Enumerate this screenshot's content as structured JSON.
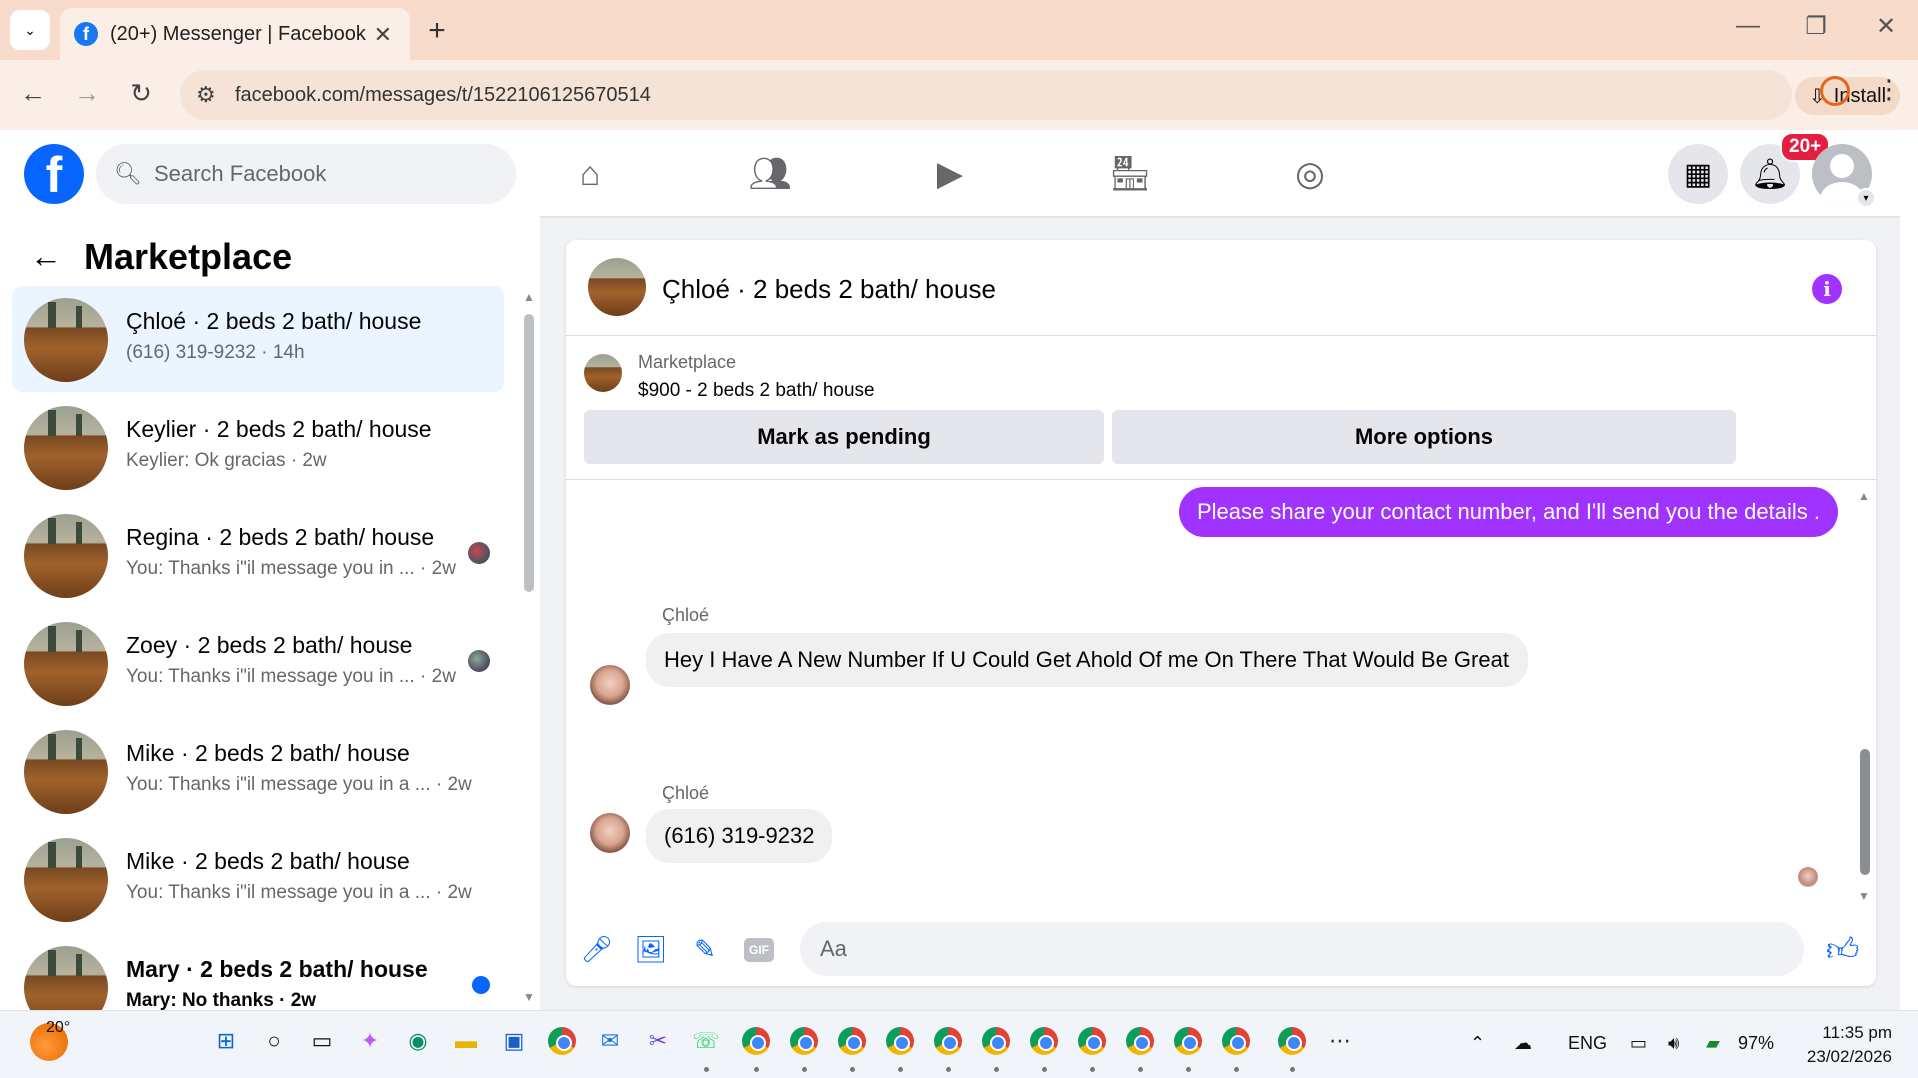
{
  "browser": {
    "tab_title": "(20+) Messenger | Facebook",
    "url": "facebook.com/messages/t/1522106125670514",
    "install_label": "Install"
  },
  "facebook": {
    "search_placeholder": "Search Facebook",
    "notifications_badge": "20+"
  },
  "sidebar": {
    "title": "Marketplace",
    "conversations": [
      {
        "name": "Çhloé · 2 beds 2 bath/ house",
        "snippet": "(616) 319-9232 · 14h",
        "active": true
      },
      {
        "name": "Keylier · 2 beds 2 bath/ house",
        "snippet": "Keylier: Ok gracias · 2w"
      },
      {
        "name": "Regina · 2 beds 2 bath/ house",
        "snippet": "You: Thanks i\"il message you in ... · 2w"
      },
      {
        "name": "Zoey · 2 beds 2 bath/ house",
        "snippet": "You: Thanks i\"il message you in ... · 2w"
      },
      {
        "name": "Mike · 2 beds 2 bath/ house",
        "snippet": "You: Thanks i\"il message you in a ...   · 2w"
      },
      {
        "name": "Mike · 2 beds 2 bath/ house",
        "snippet": "You: Thanks i\"il message you in a ...   · 2w"
      },
      {
        "name": "Mary · 2 beds 2 bath/ house",
        "snippet": "Mary: No thanks · 2w"
      }
    ]
  },
  "chat": {
    "title": "Çhloé · 2 beds 2 bath/ house",
    "marketplace_label": "Marketplace",
    "listing": "$900 - 2 beds 2 bath/ house",
    "mark_pending": "Mark as pending",
    "more_options": "More options",
    "messages": [
      {
        "from": "me",
        "text": "Please share your contact number, and I'll send you the details ."
      },
      {
        "from": "Çhloé",
        "text": "Hey I Have A New Number If U Could Get Ahold Of me On There That Would Be Great"
      },
      {
        "from": "Çhloé",
        "text": "(616) 319-9232"
      }
    ],
    "composer_placeholder": "Aa",
    "accent_color": "#a033ff"
  },
  "taskbar": {
    "temperature": "20°",
    "language": "ENG",
    "battery": "97%",
    "time": "11:35 pm",
    "date": "23/02/2026"
  }
}
